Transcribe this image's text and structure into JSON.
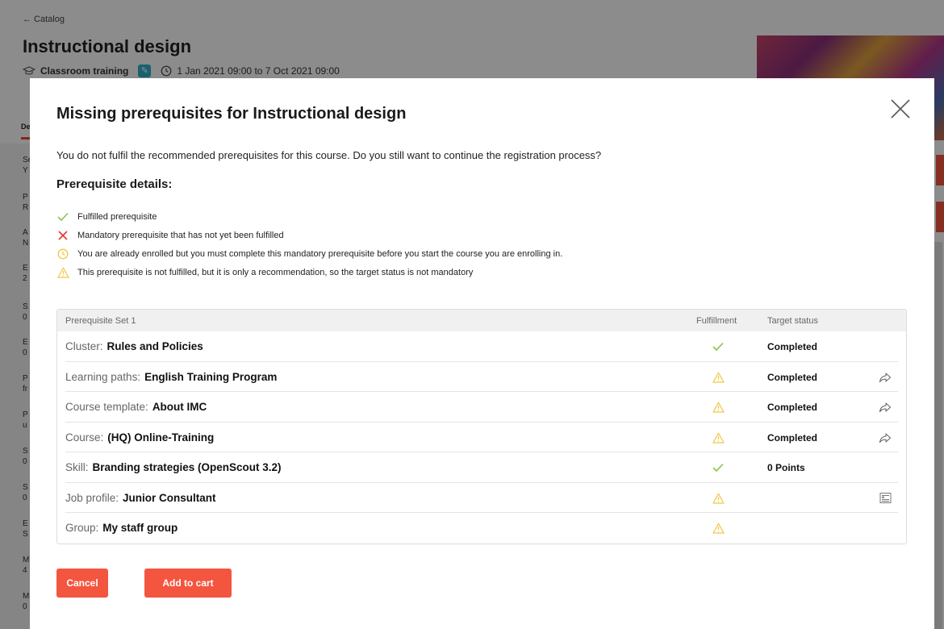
{
  "background": {
    "back_link": "← Catalog",
    "title": "Instructional design",
    "meta_type": "Classroom training",
    "meta_dates": "1 Jan 2021 09:00 to 7 Oct 2021 09:00",
    "tab_label": "De",
    "left_items": [
      [
        "Se",
        "Y"
      ],
      [
        "P",
        "R"
      ],
      [
        "A",
        "N"
      ],
      [
        "E",
        "2"
      ],
      [
        "S",
        "0"
      ],
      [
        "E",
        "0"
      ],
      [
        "P",
        "fr"
      ],
      [
        "P",
        "u"
      ],
      [
        "S",
        "0"
      ],
      [
        "S",
        "0"
      ],
      [
        "E",
        "S"
      ],
      [
        "M",
        "4"
      ],
      [
        "M",
        "0"
      ]
    ]
  },
  "modal": {
    "title": "Missing prerequisites for Instructional design",
    "intro": "You do not fulfil the recommended prerequisites for this course. Do you still want to continue the registration process?",
    "details_title": "Prerequisite details:",
    "legend": [
      {
        "icon": "check-icon",
        "text": "Fulfilled prerequisite"
      },
      {
        "icon": "cross-icon",
        "text": "Mandatory prerequisite that has not yet been fulfilled"
      },
      {
        "icon": "clock-icon",
        "text": "You are already enrolled but you must complete this mandatory prerequisite before you start the course you are enrolling in."
      },
      {
        "icon": "warning-icon",
        "text": "This prerequisite is not fulfilled, but it is only a recommendation, so the target status is not mandatory"
      }
    ],
    "table": {
      "set_label": "Prerequisite Set 1",
      "col_fulfillment": "Fulfillment",
      "col_target": "Target status",
      "rows": [
        {
          "type": "Cluster:",
          "name": "Rules and Policies",
          "fulfillment": "check",
          "status": "Completed",
          "action": ""
        },
        {
          "type": "Learning paths:",
          "name": "English Training Program",
          "fulfillment": "warning",
          "status": "Completed",
          "action": "share"
        },
        {
          "type": "Course template:",
          "name": "About IMC",
          "fulfillment": "warning",
          "status": "Completed",
          "action": "share"
        },
        {
          "type": "Course:",
          "name": "(HQ) Online-Training",
          "fulfillment": "warning",
          "status": "Completed",
          "action": "share"
        },
        {
          "type": "Skill:",
          "name": "Branding strategies (OpenScout 3.2)",
          "fulfillment": "check",
          "status": "0 Points",
          "action": ""
        },
        {
          "type": "Job profile:",
          "name": "Junior Consultant",
          "fulfillment": "warning",
          "status": "",
          "action": "profile"
        },
        {
          "type": "Group:",
          "name": "My staff group",
          "fulfillment": "warning",
          "status": "",
          "action": ""
        }
      ]
    },
    "buttons": {
      "cancel": "Cancel",
      "add_to_cart": "Add to cart"
    },
    "colors": {
      "accent": "#f4553f",
      "check": "#8bc34a",
      "cross": "#e53935",
      "warning": "#f2c744"
    }
  }
}
